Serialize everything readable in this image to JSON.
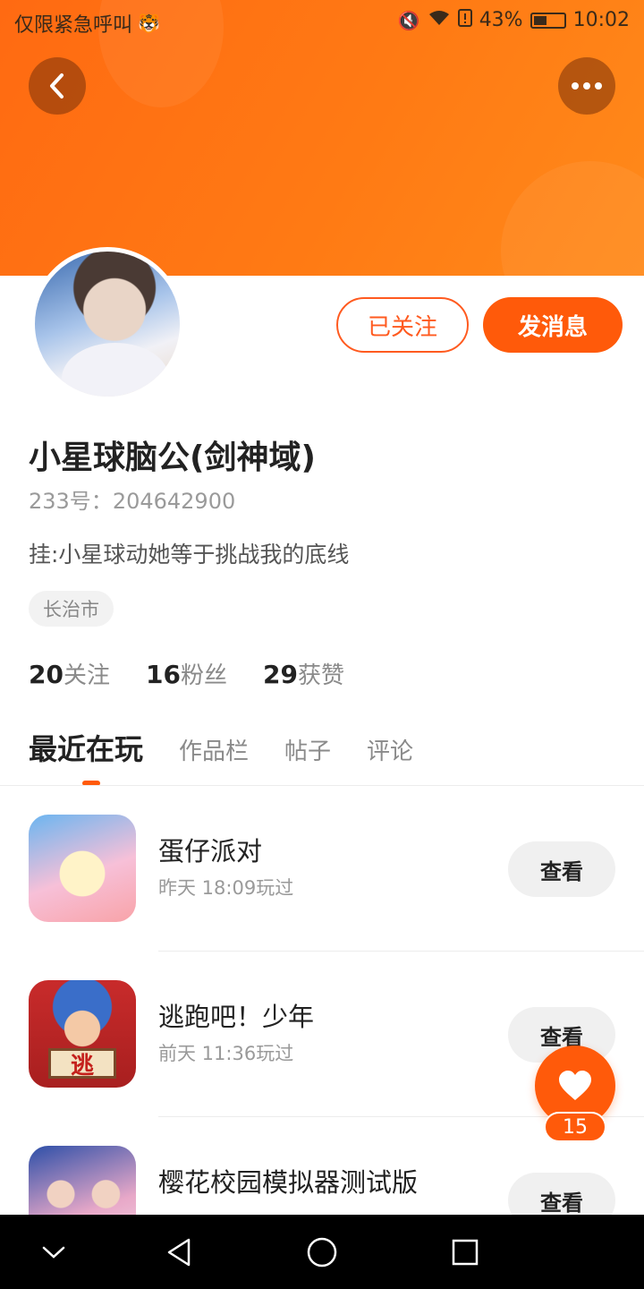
{
  "status_bar": {
    "carrier_text": "仅限紧急呼叫",
    "battery_percent": "43%",
    "time": "10:02"
  },
  "profile": {
    "name": "小星球脑公(剑神域)",
    "uid_label": "233号：",
    "uid": "204642900",
    "bio": "挂:小星球动她等于挑战我的底线",
    "city": "长治市",
    "follow_label": "已关注",
    "message_label": "发消息"
  },
  "stats": {
    "following_count": "20",
    "following_label": "关注",
    "fans_count": "16",
    "fans_label": "粉丝",
    "likes_count": "29",
    "likes_label": "获赞"
  },
  "tabs": [
    {
      "label": "最近在玩",
      "active": true
    },
    {
      "label": "作品栏",
      "active": false
    },
    {
      "label": "帖子",
      "active": false
    },
    {
      "label": "评论",
      "active": false
    }
  ],
  "games": [
    {
      "title": "蛋仔派对",
      "time": "昨天 18:09玩过",
      "action": "查看"
    },
    {
      "title": "逃跑吧！少年",
      "time": "前天 11:36玩过",
      "action": "查看",
      "icon_text": "逃"
    },
    {
      "title": "樱花校园模拟器测试版",
      "time": "",
      "action": "查看"
    }
  ],
  "like_fab": {
    "count": "15"
  },
  "colors": {
    "accent": "#ff5a0a",
    "header_gradient_start": "#ff6a12",
    "header_gradient_end": "#ff8a1a"
  },
  "icons": {
    "back": "chevron-left-icon",
    "more": "more-dots-icon",
    "like": "heart-icon",
    "nav": [
      "chevron-down-icon",
      "back-triangle-icon",
      "home-circle-icon",
      "recents-square-icon"
    ]
  }
}
